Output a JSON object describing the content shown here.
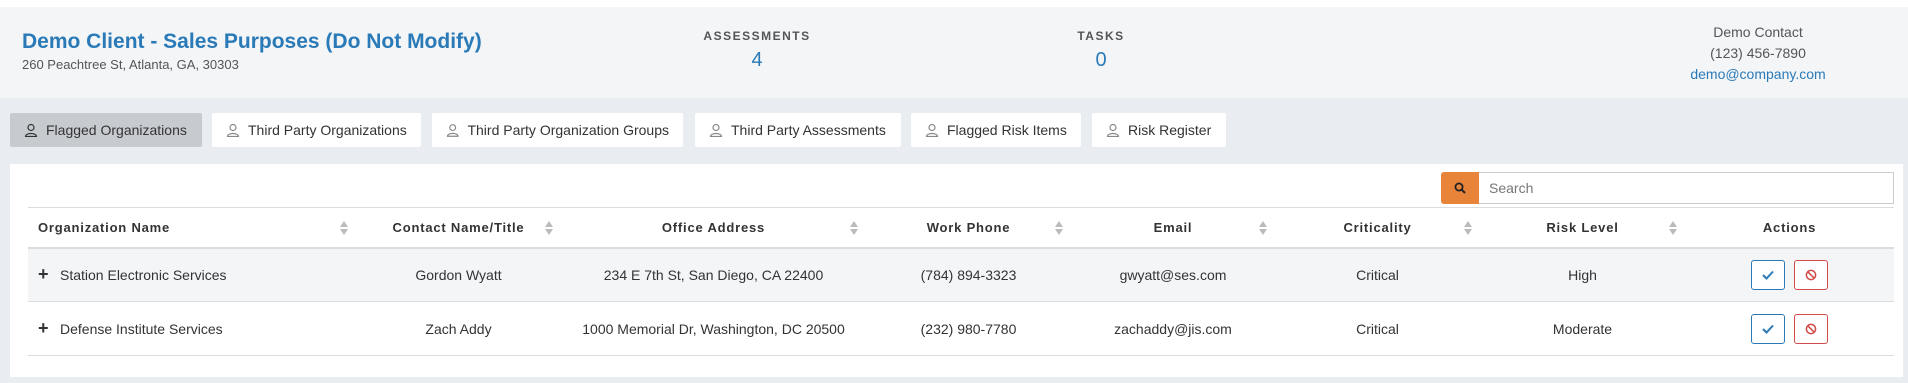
{
  "header": {
    "client_name": "Demo Client - Sales Purposes (Do Not Modify)",
    "address": "260 Peachtree St, Atlanta, GA, 30303",
    "stats": [
      {
        "label": "ASSESSMENTS",
        "value": "4"
      },
      {
        "label": "TASKS",
        "value": "0"
      }
    ],
    "contact": {
      "name": "Demo Contact",
      "phone": "(123) 456-7890",
      "email": "demo@company.com"
    }
  },
  "tabs": [
    {
      "label": "Flagged Organizations",
      "active": true
    },
    {
      "label": "Third Party Organizations",
      "active": false
    },
    {
      "label": "Third Party Organization Groups",
      "active": false
    },
    {
      "label": "Third Party Assessments",
      "active": false
    },
    {
      "label": "Flagged Risk Items",
      "active": false
    },
    {
      "label": "Risk Register",
      "active": false
    }
  ],
  "search": {
    "placeholder": "Search"
  },
  "table": {
    "columns": [
      "Organization Name",
      "Contact Name/Title",
      "Office Address",
      "Work Phone",
      "Email",
      "Criticality",
      "Risk Level",
      "Actions"
    ],
    "rows": [
      {
        "name": "Station Electronic Services",
        "contact": "Gordon Wyatt",
        "address": "234 E 7th St, San Diego, CA 22400",
        "phone": "(784) 894-3323",
        "email": "gwyatt@ses.com",
        "criticality": "Critical",
        "risk": "High"
      },
      {
        "name": "Defense Institute Services",
        "contact": "Zach Addy",
        "address": "1000 Memorial Dr, Washington, DC 20500",
        "phone": "(232) 980-7780",
        "email": "zachaddy@jis.com",
        "criticality": "Critical",
        "risk": "Moderate"
      }
    ]
  },
  "colors": {
    "accent_blue": "#2a7ab8",
    "search_orange": "#e8833a",
    "deny_red": "#d24b4b"
  }
}
